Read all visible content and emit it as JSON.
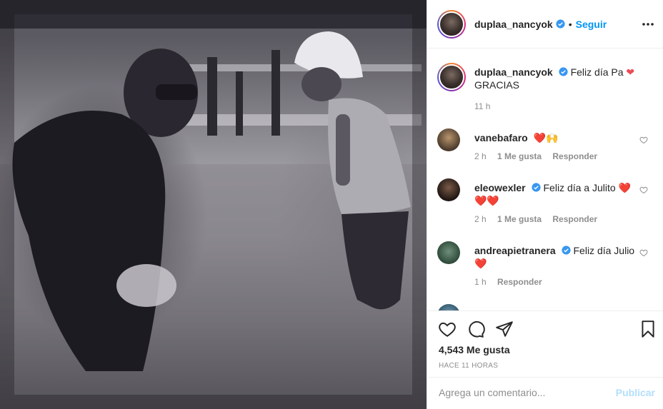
{
  "photo": {
    "description_icon": "photo-image"
  },
  "header": {
    "username": "duplaa_nancyok",
    "separator": "•",
    "follow_label": "Seguir"
  },
  "caption": {
    "username": "duplaa_nancyok",
    "text_line1": "Feliz día Pa",
    "text_line2": "GRACIAS",
    "time": "11 h"
  },
  "comments": [
    {
      "username": "vanebafaro",
      "text": "",
      "emoji": "❤️🙌",
      "time": "2 h",
      "likes": "1 Me gusta",
      "reply": "Responder"
    },
    {
      "username": "eleowexler",
      "text": "Feliz día a Julito",
      "emoji": "❤️❤️❤️",
      "time": "2 h",
      "likes": "1 Me gusta",
      "reply": "Responder"
    },
    {
      "username": "andreapietranera",
      "text": "Feliz día Julio",
      "emoji": "❤️",
      "time": "1 h",
      "likes": "",
      "reply": "Responder"
    }
  ],
  "actions": {
    "likes": "4,543 Me gusta",
    "time_ago": "HACE 11 HORAS"
  },
  "add_comment": {
    "placeholder": "Agrega un comentario...",
    "publish_label": "Publicar"
  },
  "colors": {
    "accent": "#0095f6",
    "heart": "#ed4956",
    "muted": "#8e8e8e",
    "border": "#efefef"
  }
}
